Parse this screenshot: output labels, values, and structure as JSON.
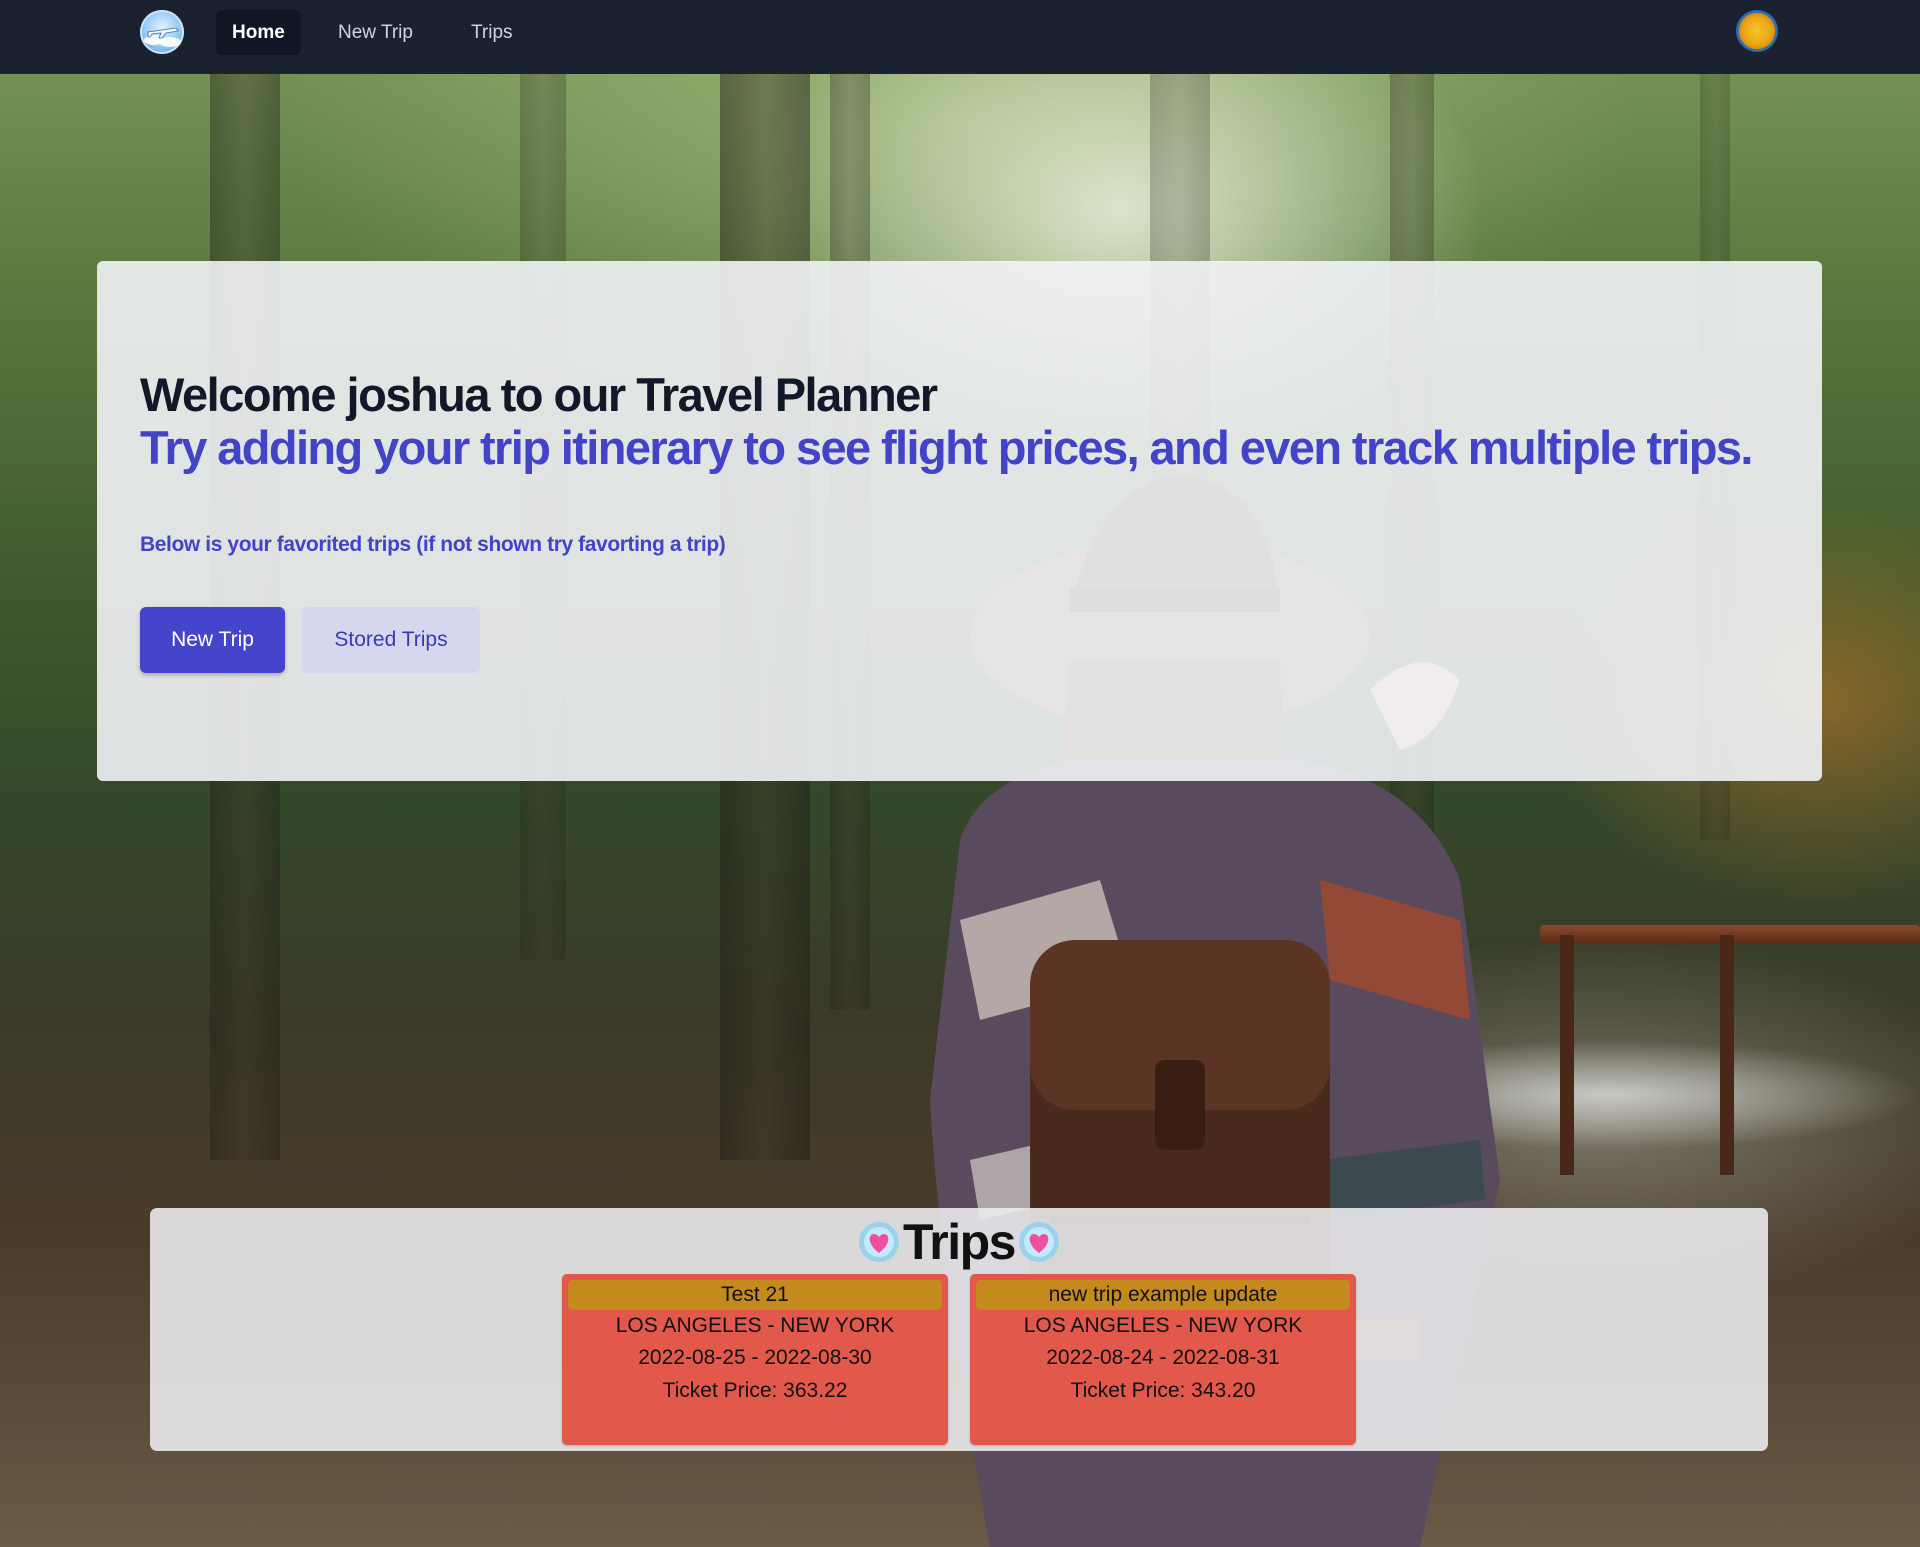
{
  "nav": {
    "logo": "travel-logo",
    "links": [
      "Home",
      "New Trip",
      "Trips"
    ],
    "active": "Home",
    "avatar": "sun-avatar"
  },
  "hero": {
    "title": "Welcome joshua to our Travel Planner",
    "subtitle": "Try adding your trip itinerary to see flight prices, and even track multiple trips.",
    "note": "Below is your favorited trips (if not shown try favorting a trip)",
    "primary_button": "New Trip",
    "secondary_button": "Stored Trips"
  },
  "favorites": {
    "heading": "Trips",
    "heading_icon": "heart-icon",
    "trips": [
      {
        "name": "Test 21",
        "route": "LOS ANGELES - NEW YORK",
        "dates": "2022-08-25 - 2022-08-30",
        "price": "Ticket Price: 363.22"
      },
      {
        "name": "new trip example update",
        "route": "LOS ANGELES - NEW YORK",
        "dates": "2022-08-24 - 2022-08-31",
        "price": "Ticket Price: 343.20"
      }
    ]
  },
  "colors": {
    "navbar": "#1a2232",
    "accent": "#4545cc",
    "card": "#e2584a",
    "card_header": "#c58a1e"
  }
}
